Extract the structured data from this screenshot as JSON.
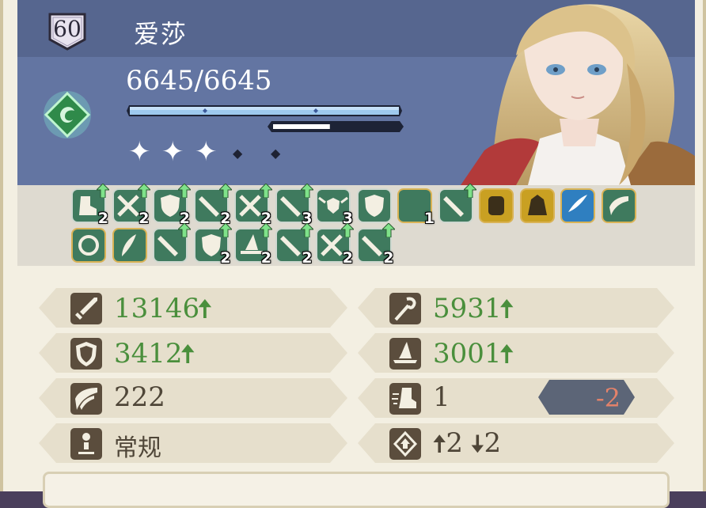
{
  "character": {
    "level": "60",
    "name": "爱莎",
    "hp": "6645/6645",
    "hp_fraction": 1.0,
    "sub_fraction": 0.46,
    "stars_filled": 3,
    "stars_total": 5
  },
  "buffs_row1": [
    {
      "icon": "boot-up-icon",
      "count": "2",
      "up": true
    },
    {
      "icon": "crossed-swords-up-icon",
      "count": "2",
      "up": true
    },
    {
      "icon": "shield-up-icon",
      "count": "2",
      "up": true
    },
    {
      "icon": "sword-up-icon",
      "count": "2",
      "up": true
    },
    {
      "icon": "crossed-swords-up-icon",
      "count": "2",
      "up": true
    },
    {
      "icon": "sword-up-icon",
      "count": "3",
      "up": true
    },
    {
      "icon": "wings-shield-icon",
      "count": "3",
      "up": false
    },
    {
      "icon": "shield-icon",
      "count": "",
      "up": false
    },
    {
      "icon": "crescent-moon-icon",
      "count": "1",
      "up": false
    },
    {
      "icon": "sword-up-icon",
      "count": "",
      "up": true
    },
    {
      "icon": "fist-icon",
      "count": "",
      "up": false
    },
    {
      "icon": "guardian-icon",
      "count": "",
      "up": false
    },
    {
      "icon": "blade-slash-icon",
      "count": "",
      "up": false
    },
    {
      "icon": "wing-icon",
      "count": "",
      "up": false
    }
  ],
  "buffs_row2": [
    {
      "icon": "swirl-icon",
      "count": "",
      "up": false
    },
    {
      "icon": "feather-icon",
      "count": "",
      "up": false
    },
    {
      "icon": "sword-up-icon",
      "count": "",
      "up": true
    },
    {
      "icon": "shield-up-icon",
      "count": "2",
      "up": true
    },
    {
      "icon": "hat-up-icon",
      "count": "2",
      "up": true
    },
    {
      "icon": "sword-up-icon",
      "count": "2",
      "up": true
    },
    {
      "icon": "crossed-swords-up-icon",
      "count": "2",
      "up": true
    },
    {
      "icon": "sword-up-icon",
      "count": "2",
      "up": true
    }
  ],
  "stats": {
    "attack": {
      "icon": "sword-icon",
      "value": "13146",
      "up": true
    },
    "magic_attack": {
      "icon": "staff-icon",
      "value": "5931",
      "up": true
    },
    "defense": {
      "icon": "shield-icon",
      "value": "3412",
      "up": true
    },
    "magic_defense": {
      "icon": "wizard-hat-icon",
      "value": "3001",
      "up": true
    },
    "speed": {
      "icon": "wing-icon",
      "value": "222"
    },
    "move": {
      "icon": "boot-icon",
      "value": "1",
      "modifier": "-2"
    },
    "type": {
      "icon": "person-icon",
      "value": "常规"
    },
    "jump": {
      "icon": "jump-icon",
      "up_value": "2",
      "down_value": "2"
    }
  },
  "colors": {
    "header": "#6375a2",
    "buff_bg": "#dedad0",
    "stat_green": "#4a8f3c",
    "stat_text": "#4f4638",
    "modifier_red": "#e3826a"
  }
}
